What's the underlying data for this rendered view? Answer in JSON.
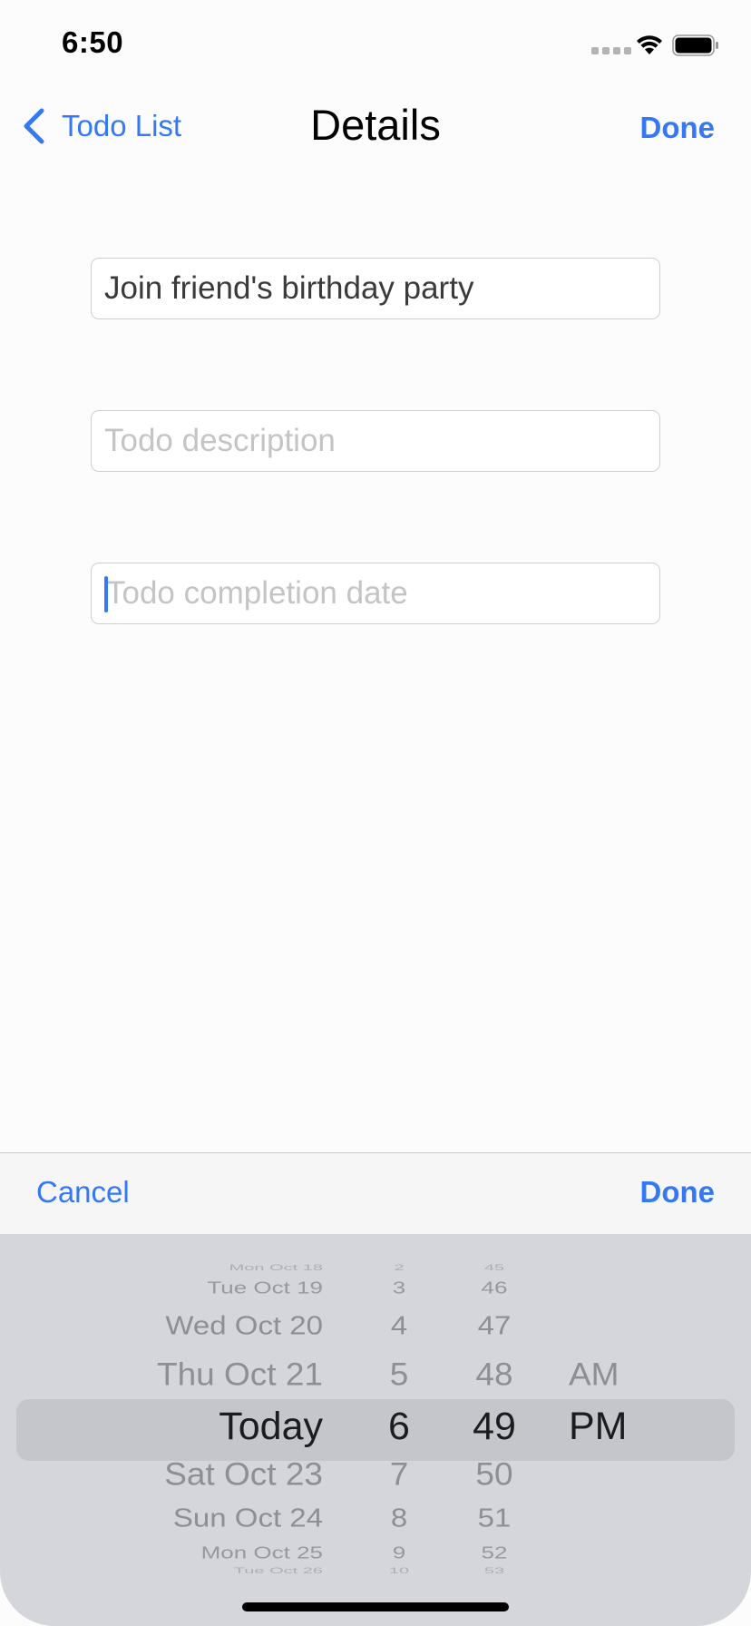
{
  "status_bar": {
    "time": "6:50"
  },
  "nav": {
    "back_label": "Todo List",
    "title": "Details",
    "done_label": "Done"
  },
  "fields": {
    "title_value": "Join friend's birthday party",
    "description_placeholder": "Todo description",
    "date_placeholder": "Todo completion date"
  },
  "toolbar": {
    "cancel_label": "Cancel",
    "done_label": "Done"
  },
  "picker": {
    "dates": [
      "Mon Oct 18",
      "Tue Oct 19",
      "Wed Oct 20",
      "Thu Oct 21",
      "Today",
      "Sat Oct 23",
      "Sun Oct 24",
      "Mon Oct 25",
      "Tue Oct 26"
    ],
    "hours": [
      "2",
      "3",
      "4",
      "5",
      "6",
      "7",
      "8",
      "9",
      "10"
    ],
    "minutes": [
      "45",
      "46",
      "47",
      "48",
      "49",
      "50",
      "51",
      "52",
      "53"
    ],
    "ampm": [
      "AM",
      "PM"
    ],
    "selected": {
      "date": "Today",
      "hour": "6",
      "minute": "49",
      "ampm": "PM"
    }
  },
  "colors": {
    "accent": "#3478f6",
    "picker_bg": "#d4d6dc",
    "toolbar_bg": "#f6f6f6"
  }
}
